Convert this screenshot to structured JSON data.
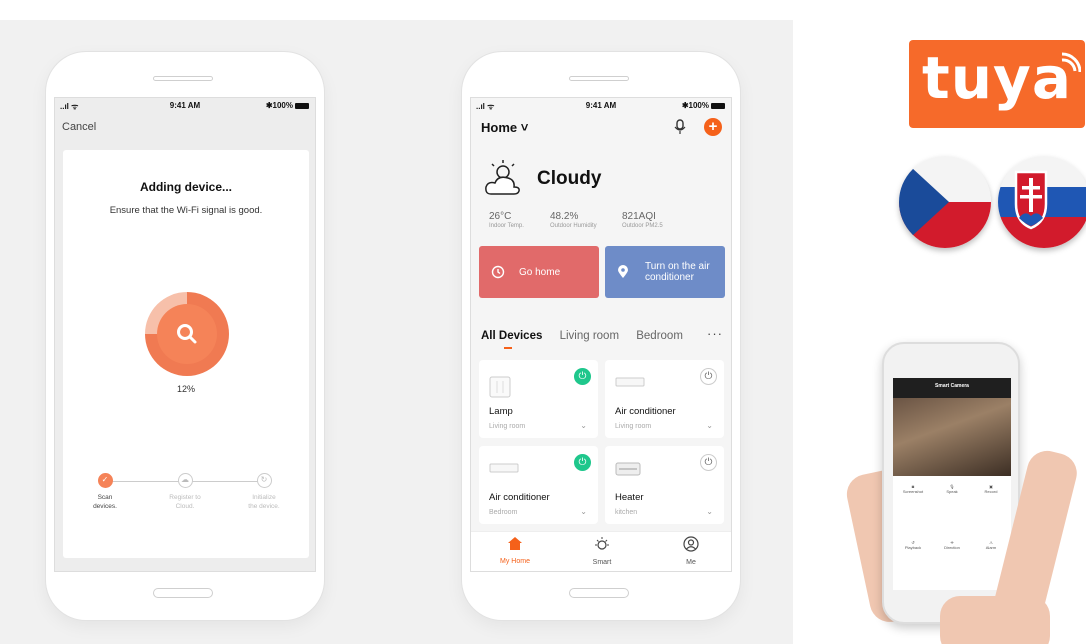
{
  "phone1": {
    "status": {
      "signal": "..ıl ᯤ",
      "time": "9:41 AM",
      "battery": "✱100%"
    },
    "cancel": "Cancel",
    "title": "Adding device...",
    "subtitle": "Ensure that the Wi-Fi signal is good.",
    "progress_label": "12%",
    "progress_value": 0.12,
    "steps": [
      {
        "line1": "Scan",
        "line2": "devices.",
        "icon": "check-icon"
      },
      {
        "line1": "Register to",
        "line2": "Cloud.",
        "icon": "cloud-icon"
      },
      {
        "line1": "Initialize",
        "line2": "the device.",
        "icon": "refresh-icon"
      }
    ]
  },
  "phone2": {
    "status": {
      "signal": "..ıl ᯤ",
      "time": "9:41 AM",
      "battery": "✱100%"
    },
    "home": "Home ˅",
    "weather": "Cloudy",
    "stats": [
      {
        "value": "26°C",
        "label": "Indoor Temp."
      },
      {
        "value": "48.2%",
        "label": "Outdoor Humidity"
      },
      {
        "value": "821AQI",
        "label": "Outdoor PM2.5"
      }
    ],
    "scenes": [
      {
        "label": "Go home",
        "color": "#e16a6a"
      },
      {
        "line1": "Turn on the air",
        "line2": "conditioner",
        "color": "#6e8cc8"
      }
    ],
    "tabs": [
      "All Devices",
      "Living room",
      "Bedroom"
    ],
    "more": "···",
    "devices": [
      {
        "name": "Lamp",
        "room": "Living room",
        "on": true
      },
      {
        "name": "Air conditioner",
        "room": "Living room",
        "on": false
      },
      {
        "name": "Air conditioner",
        "room": "Bedroom",
        "on": true
      },
      {
        "name": "Heater",
        "room": "kitchen",
        "on": false
      }
    ],
    "tabbar": [
      {
        "label": "My Home",
        "icon": "home-icon",
        "active": true
      },
      {
        "label": "Smart",
        "icon": "sun-icon",
        "active": false
      },
      {
        "label": "Me",
        "icon": "user-icon",
        "active": false
      }
    ]
  },
  "brand": {
    "logo_text": "tuya",
    "color": "#f66a2a"
  },
  "flags": [
    "czech-flag",
    "slovak-flag"
  ],
  "camera_app": {
    "title": "Smart Camera",
    "controls": [
      "Screenshot",
      "Speak",
      "Record",
      "Playback",
      "Direction",
      "Alarm"
    ]
  }
}
